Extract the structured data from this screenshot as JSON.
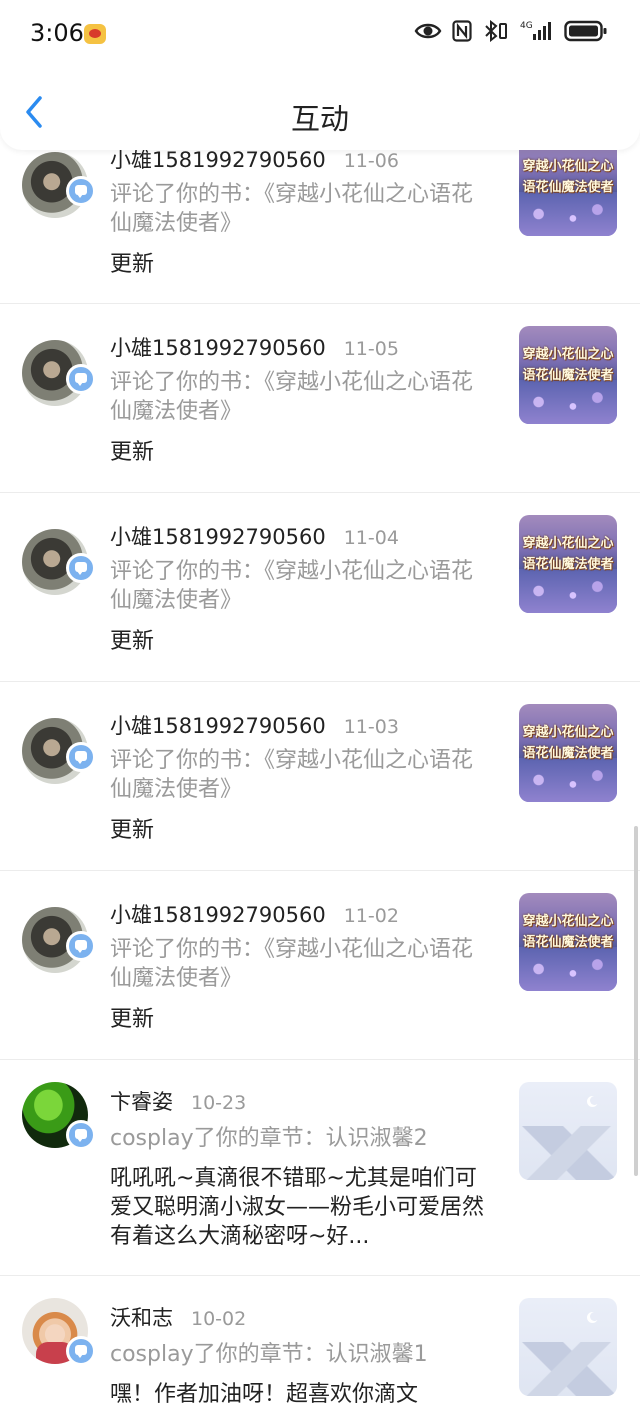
{
  "status_bar": {
    "time": "3:06",
    "network": "4G"
  },
  "header": {
    "title": "互动"
  },
  "items": [
    {
      "name": "小雄1581992790560",
      "date": "11-06",
      "action": "评论了你的书：《穿越小花仙之心语花仙魔法使者》",
      "body": "更新",
      "thumb_text": "穿越小花仙之心语花仙魔法使者"
    },
    {
      "name": "小雄1581992790560",
      "date": "11-05",
      "action": "评论了你的书：《穿越小花仙之心语花仙魔法使者》",
      "body": "更新",
      "thumb_text": "穿越小花仙之心语花仙魔法使者"
    },
    {
      "name": "小雄1581992790560",
      "date": "11-04",
      "action": "评论了你的书：《穿越小花仙之心语花仙魔法使者》",
      "body": "更新",
      "thumb_text": "穿越小花仙之心语花仙魔法使者"
    },
    {
      "name": "小雄1581992790560",
      "date": "11-03",
      "action": "评论了你的书：《穿越小花仙之心语花仙魔法使者》",
      "body": "更新",
      "thumb_text": "穿越小花仙之心语花仙魔法使者"
    },
    {
      "name": "小雄1581992790560",
      "date": "11-02",
      "action": "评论了你的书：《穿越小花仙之心语花仙魔法使者》",
      "body": "更新",
      "thumb_text": "穿越小花仙之心语花仙魔法使者"
    },
    {
      "name": "卞睿姿",
      "date": "10-23",
      "action": "cosplay了你的章节：认识淑馨2",
      "body": "吼吼吼~真滴很不错耶~尤其是咱们可爱又聪明滴小淑女——粉毛小可爱居然有着这么大滴秘密呀~好..."
    },
    {
      "name": "沃和志",
      "date": "10-02",
      "action": "cosplay了你的章节：认识淑馨1",
      "body": "嘿！作者加油呀！超喜欢你滴文"
    }
  ]
}
